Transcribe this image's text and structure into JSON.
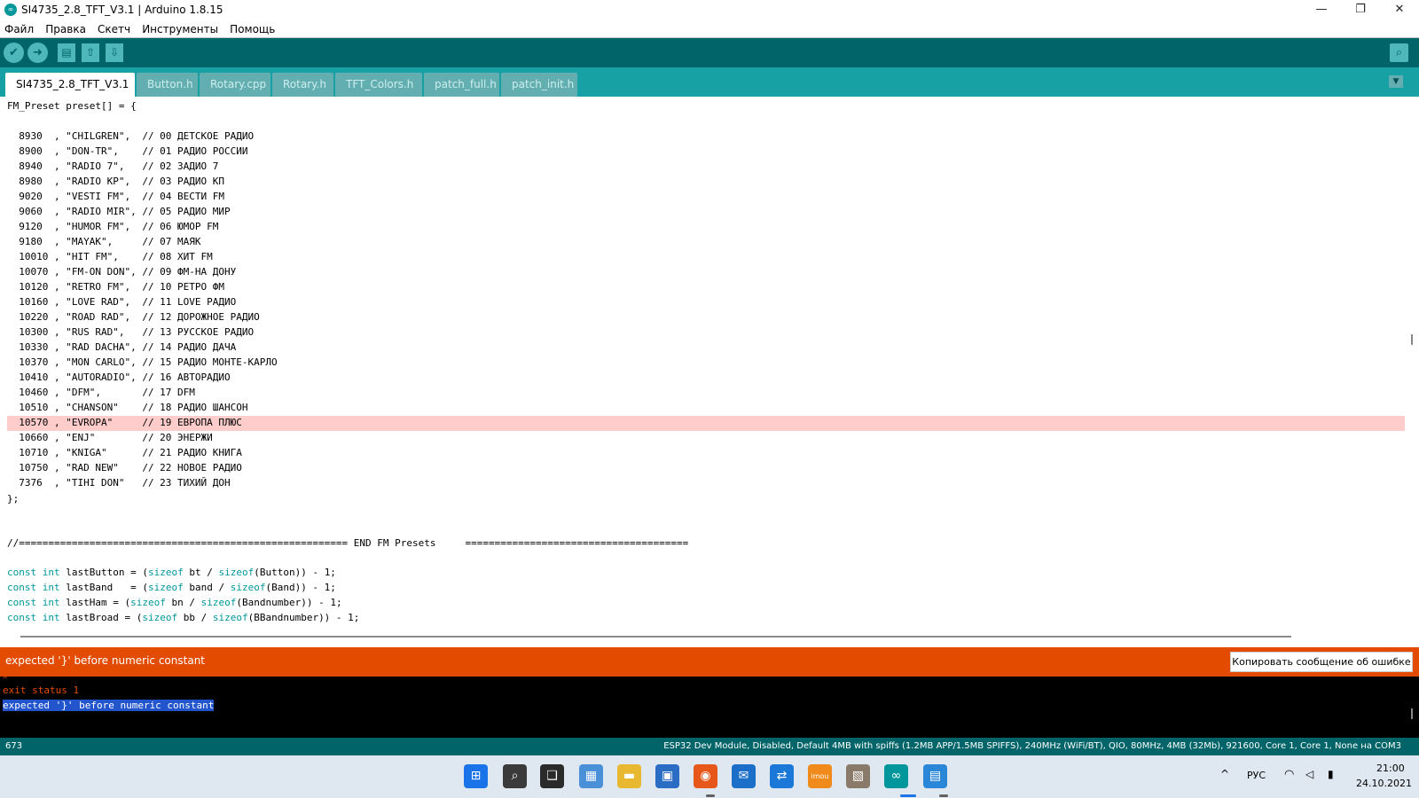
{
  "window": {
    "title": "SI4735_2.8_TFT_V3.1 | Arduino 1.8.15",
    "logo_symbol": "∞",
    "minimize_symbol": "—",
    "restore_symbol": "❐",
    "close_symbol": "✕"
  },
  "menu": [
    "Файл",
    "Правка",
    "Скетч",
    "Инструменты",
    "Помощь"
  ],
  "toolbar": {
    "verify_symbol": "✔",
    "upload_symbol": "➜",
    "new_symbol": "▤",
    "open_symbol": "⇧",
    "save_symbol": "⇩",
    "serial_symbol": "⌕"
  },
  "tabs": [
    {
      "label": "SI4735_2.8_TFT_V3.1",
      "active": true
    },
    {
      "label": "Button.h",
      "active": false
    },
    {
      "label": "Rotary.cpp",
      "active": false
    },
    {
      "label": "Rotary.h",
      "active": false
    },
    {
      "label": "TFT_Colors.h",
      "active": false
    },
    {
      "label": "patch_full.h",
      "active": false
    },
    {
      "label": "patch_init.h",
      "active": false
    }
  ],
  "tab_menu_symbol": "▼",
  "code": {
    "header": "FM_Preset preset[] = {",
    "presets": [
      "  8930  , \"CHILGREN\",  // 00 ДЕТСКОЕ РАДИО",
      "  8900  , \"DON-TR\",    // 01 РАДИО РОССИИ",
      "  8940  , \"RADIO 7\",   // 02 ЗАДИО 7",
      "  8980  , \"RADIO KP\",  // 03 РАДИО КП",
      "  9020  , \"VESTI FM\",  // 04 ВЕСТИ FM",
      "  9060  , \"RADIO MIR\", // 05 РАДИО МИР",
      "  9120  , \"HUMOR FM\",  // 06 ЮМОР FM",
      "  9180  , \"MAYAK\",     // 07 МАЯК",
      "  10010 , \"HIT FM\",    // 08 ХИТ FM",
      "  10070 , \"FM-ON DON\", // 09 ФМ-НА ДОНУ",
      "  10120 , \"RETRO FM\",  // 10 РЕТРО ФМ",
      "  10160 , \"LOVE RAD\",  // 11 LOVE РАДИО",
      "  10220 , \"ROAD RAD\",  // 12 ДОРОЖНОЕ РАДИО",
      "  10300 , \"RUS RAD\",   // 13 РУССКОЕ РАДИО",
      "  10330 , \"RAD DACHA\", // 14 РАДИО ДАЧА",
      "  10370 , \"MON CARLO\", // 15 РАДИО МОНТЕ-КАРЛО",
      "  10410 , \"AUTORADIO\", // 16 АВТОРАДИО",
      "  10460 , \"DFM\",       // 17 DFM",
      "  10510 , \"CHANSON\"    // 18 РАДИО ШАНСОН",
      "  10570 , \"EVROPA\"     // 19 ЕВРОПА ПЛЮС",
      "  10660 , \"ENJ\"        // 20 ЭНЕРЖИ",
      "  10710 , \"KNIGA\"      // 21 РАДИО КНИГА",
      "  10750 , \"RAD NEW\"    // 22 НОВОЕ РАДИО",
      "  7376  , \"TIHI DON\"   // 23 ТИХИЙ ДОН"
    ],
    "highlighted_index": 19,
    "close": "};",
    "separator": "//======================================================== END FM Presets     ======================================",
    "decls": [
      {
        "kw1": "const",
        "kw2": "int",
        "name": " lastButton = (",
        "sz1": "sizeof",
        "mid": " bt / ",
        "sz2": "sizeof",
        "tail": "(Button)) - 1;"
      },
      {
        "kw1": "const",
        "kw2": "int",
        "name": " lastBand   = (",
        "sz1": "sizeof",
        "mid": " band / ",
        "sz2": "sizeof",
        "tail": "(Band)) - 1;"
      },
      {
        "kw1": "const",
        "kw2": "int",
        "name": " lastHam = (",
        "sz1": "sizeof",
        "mid": " bn / ",
        "sz2": "sizeof",
        "tail": "(Bandnumber)) - 1;"
      },
      {
        "kw1": "const",
        "kw2": "int",
        "name": " lastBroad = (",
        "sz1": "sizeof",
        "mid": " bb / ",
        "sz2": "sizeof",
        "tail": "(BBandnumber)) - 1;"
      }
    ]
  },
  "error_bar": {
    "message": "expected '}' before numeric constant",
    "copy_button": "Копировать сообщение об ошибке"
  },
  "console": {
    "caret": "^",
    "exit_status": "exit status 1",
    "error": "expected '}' before numeric constant"
  },
  "status": {
    "line": "673",
    "board": "ESP32 Dev Module, Disabled, Default 4MB with spiffs (1.2MB APP/1.5MB SPIFFS), 240MHz (WiFi/BT), QIO, 80MHz, 4MB (32Mb), 921600, Core 1, Core 1, None на COM3"
  },
  "taskbar": {
    "icons": [
      {
        "name": "start-icon",
        "symbol": "⊞",
        "color": "#1a73e8"
      },
      {
        "name": "search-icon",
        "symbol": "⌕",
        "color": "#3a3a3a"
      },
      {
        "name": "task-view-icon",
        "symbol": "❑",
        "color": "#2a2a2a"
      },
      {
        "name": "widgets-icon",
        "symbol": "▦",
        "color": "#4a90d9"
      },
      {
        "name": "file-explorer-icon",
        "symbol": "▬",
        "color": "#e8b830"
      },
      {
        "name": "store-icon",
        "symbol": "▣",
        "color": "#2b6cc4"
      },
      {
        "name": "firefox-icon",
        "symbol": "◉",
        "color": "#e8571a"
      },
      {
        "name": "mail-icon",
        "symbol": "✉",
        "color": "#1c6fc9"
      },
      {
        "name": "teamviewer-icon",
        "symbol": "⇄",
        "color": "#1b78d8"
      },
      {
        "name": "imou-icon",
        "symbol": "imou",
        "color": "#f08a1a"
      },
      {
        "name": "network-app-icon",
        "symbol": "▧",
        "color": "#8a7a6a"
      },
      {
        "name": "arduino-icon",
        "symbol": "∞",
        "color": "#00979c"
      },
      {
        "name": "notepad-icon",
        "symbol": "▤",
        "color": "#2a86d6"
      }
    ],
    "tray_chevron": "^",
    "language": "РУС",
    "wifi_symbol": "◠",
    "volume_symbol": "◁",
    "battery_symbol": "▮",
    "time": "21:00",
    "date": "24.10.2021"
  }
}
